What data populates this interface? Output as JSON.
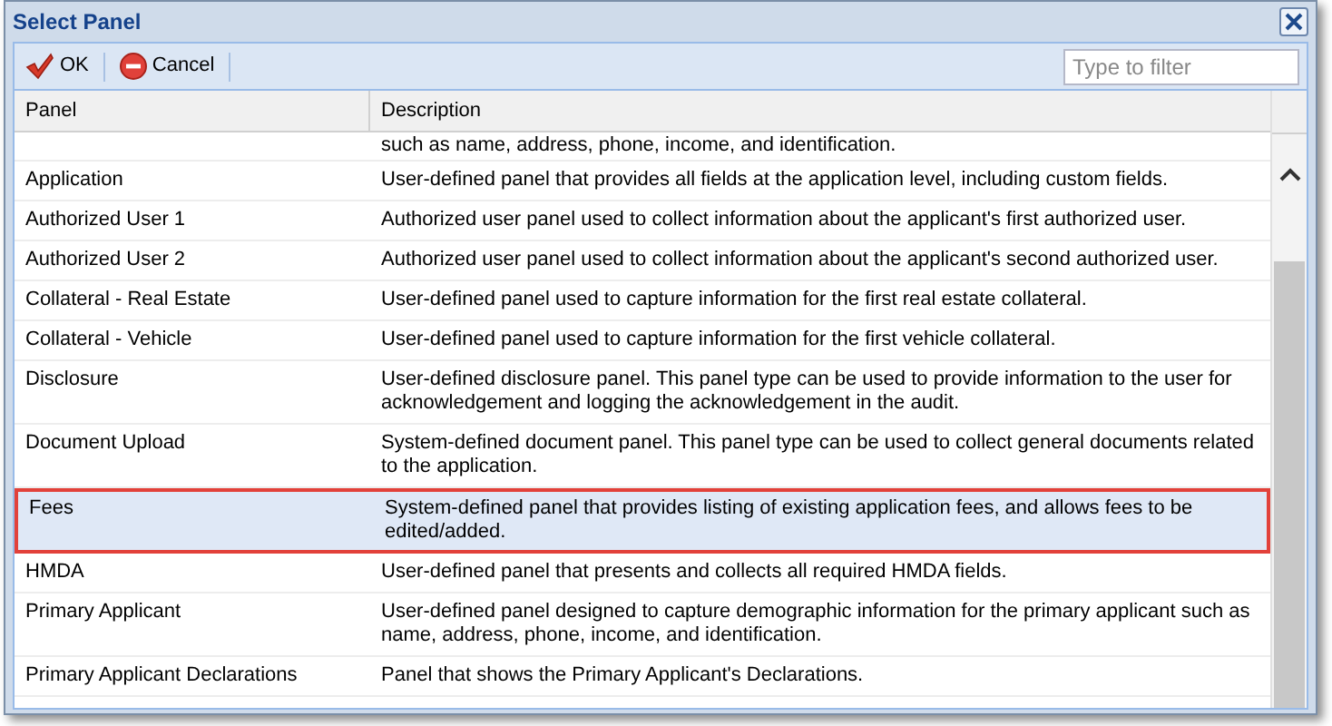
{
  "window": {
    "title": "Select Panel"
  },
  "toolbar": {
    "buttons": [
      {
        "kind": "ok",
        "label": "OK"
      },
      {
        "kind": "cancel",
        "label": "Cancel"
      }
    ],
    "filter": {
      "placeholder": "Type to filter"
    }
  },
  "table": {
    "columns": [
      "Panel",
      "Description"
    ],
    "rows": [
      {
        "description": "such as name, address, phone, income, and identification.",
        "selected": false
      },
      {
        "panel": "Application",
        "description": "User-defined panel that provides all fields at the application level, including custom fields.",
        "selected": false
      },
      {
        "panel": "Authorized User 1",
        "description": "Authorized user panel used to collect information about the applicant's first authorized user.",
        "selected": false
      },
      {
        "panel": "Authorized User 2",
        "description": "Authorized user panel used to collect information about the applicant's second authorized user.",
        "selected": false
      },
      {
        "panel": "Collateral - Real Estate",
        "description": "User-defined panel used to capture information for the first real estate collateral.",
        "selected": false
      },
      {
        "panel": "Collateral - Vehicle",
        "description": "User-defined panel used to capture information for the first vehicle collateral.",
        "selected": false
      },
      {
        "panel": "Disclosure",
        "description": "User-defined disclosure panel. This panel type can be used to provide information to the user for acknowledgement and logging the acknowledgement in the audit.",
        "selected": false
      },
      {
        "panel": "Document Upload",
        "description": "System-defined document panel. This panel type can be used to collect general documents related to the application.",
        "selected": false
      },
      {
        "panel": "Fees",
        "description": "System-defined panel that provides listing of existing application fees, and allows fees to be edited/added.",
        "selected": true
      },
      {
        "panel": "HMDA",
        "description": "User-defined panel that presents and collects all required HMDA fields.",
        "selected": false
      },
      {
        "panel": "Primary Applicant",
        "description": "User-defined panel designed to capture demographic information for the primary applicant such as name, address, phone, income, and identification.",
        "selected": false
      },
      {
        "panel": "Primary Applicant Declarations",
        "description": "Panel that shows the Primary Applicant's Declarations.",
        "selected": false
      }
    ]
  }
}
